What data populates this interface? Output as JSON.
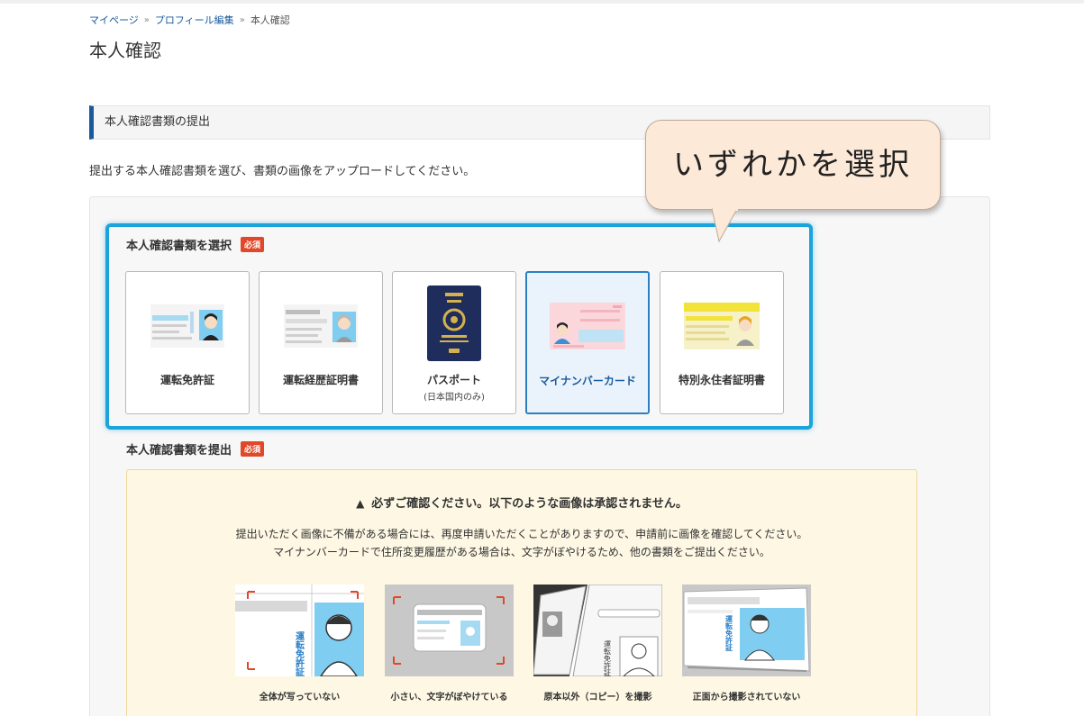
{
  "breadcrumb": {
    "items": [
      "マイページ",
      "プロフィール編集",
      "本人確認"
    ],
    "separator": "»"
  },
  "page": {
    "title": "本人確認"
  },
  "section": {
    "title": "本人確認書類の提出",
    "intro": "提出する本人確認書類を選び、書類の画像をアップロードしてください。"
  },
  "select": {
    "label": "本人確認書類を選択",
    "required": "必須",
    "options": [
      {
        "name": "運転免許証",
        "sub": ""
      },
      {
        "name": "運転経歴証明書",
        "sub": ""
      },
      {
        "name": "パスポート",
        "sub": "(日本国内のみ)"
      },
      {
        "name": "マイナンバーカード",
        "sub": "",
        "selected": true
      },
      {
        "name": "特別永住者証明書",
        "sub": ""
      }
    ]
  },
  "submit": {
    "label": "本人確認書類を提出",
    "required": "必須"
  },
  "callout": {
    "text": "いずれかを選択"
  },
  "warning": {
    "title": "必ずご確認ください。以下のような画像は承認されません。",
    "lines": [
      "提出いただく画像に不備がある場合には、再度申請いただくことがありますので、申請前に画像を確認してください。",
      "マイナンバーカードで住所変更履歴がある場合は、文字がぼやけるため、他の書類をご提出ください。"
    ],
    "examples": [
      {
        "caption": "全体が写っていない"
      },
      {
        "caption": "小さい、文字がぼやけている"
      },
      {
        "caption": "原本以外（コピー）を撮影"
      },
      {
        "caption": "正面から撮影されていない"
      }
    ]
  },
  "colors": {
    "accent": "#1a5a9c",
    "highlight": "#1ba4dc",
    "required": "#e0482a",
    "warning_bg": "#fdf7e3"
  }
}
